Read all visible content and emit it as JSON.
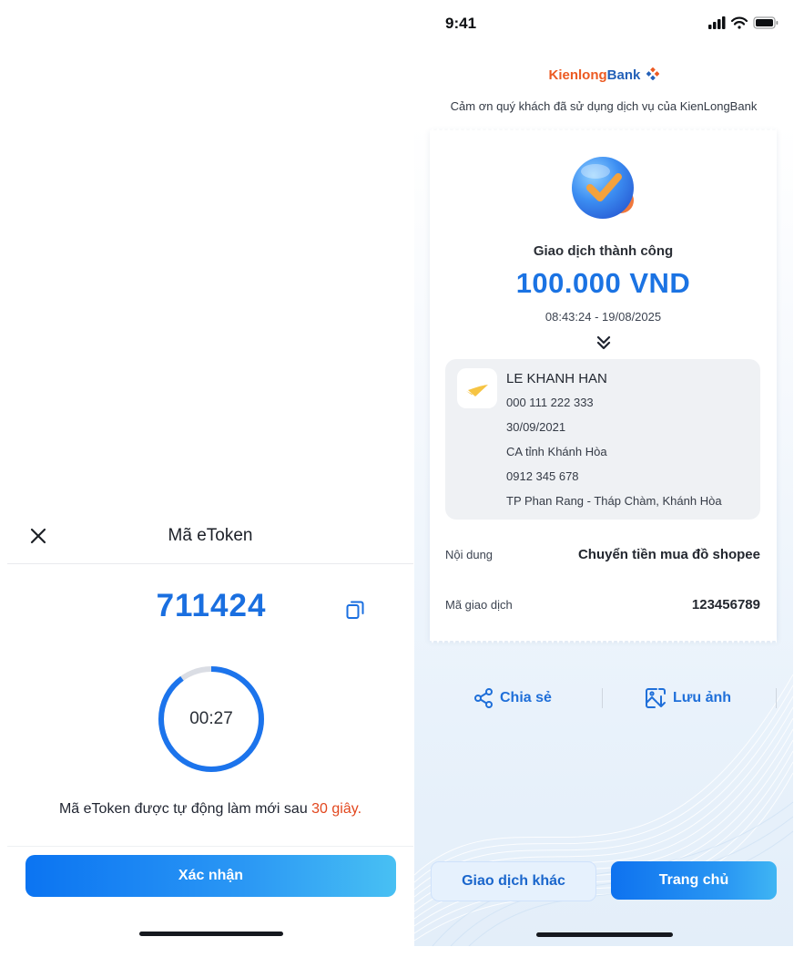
{
  "etoken": {
    "title": "Mã eToken",
    "code": "711424",
    "timer": "00:27",
    "timer_progress": 0.9,
    "refresh_prefix": "Mã eToken được tự động làm mới sau ",
    "refresh_seconds": "30 giây.",
    "confirm_label": "Xác nhận"
  },
  "status_bar": {
    "time": "9:41"
  },
  "brand": {
    "part1": "Kienlong",
    "part2": "Bank"
  },
  "thanks": "Cảm ơn quý khách đã sử dụng dịch vụ của KienLongBank",
  "receipt": {
    "status": "Giao dịch thành công",
    "amount": "100.000 VND",
    "datetime": "08:43:24 - 19/08/2025",
    "recipient": {
      "name": "LE KHANH HAN",
      "lines": [
        "000 111 222 333",
        "30/09/2021",
        "CA tỉnh Khánh Hòa",
        "0912 345 678",
        "TP Phan Rang - Tháp Chàm, Khánh Hòa"
      ]
    },
    "content_label": "Nội dung",
    "content_value": "Chuyển tiền mua đồ shopee",
    "txid_label": "Mã giao dịch",
    "txid_value": "123456789"
  },
  "actions": {
    "share": "Chia sẻ",
    "save": "Lưu ảnh"
  },
  "buttons": {
    "other": "Giao dịch khác",
    "home": "Trang chủ"
  },
  "colors": {
    "primary": "#1b73e3",
    "accent_orange": "#e2471e",
    "brand_orange": "#ec5a22",
    "brand_blue": "#2461b8"
  },
  "icons": [
    "close-icon",
    "copy-icon",
    "signal-icon",
    "wifi-icon",
    "battery-icon",
    "success-check-icon",
    "chevron-double-down-icon",
    "recipient-bank-logo",
    "share-icon",
    "save-image-icon"
  ]
}
